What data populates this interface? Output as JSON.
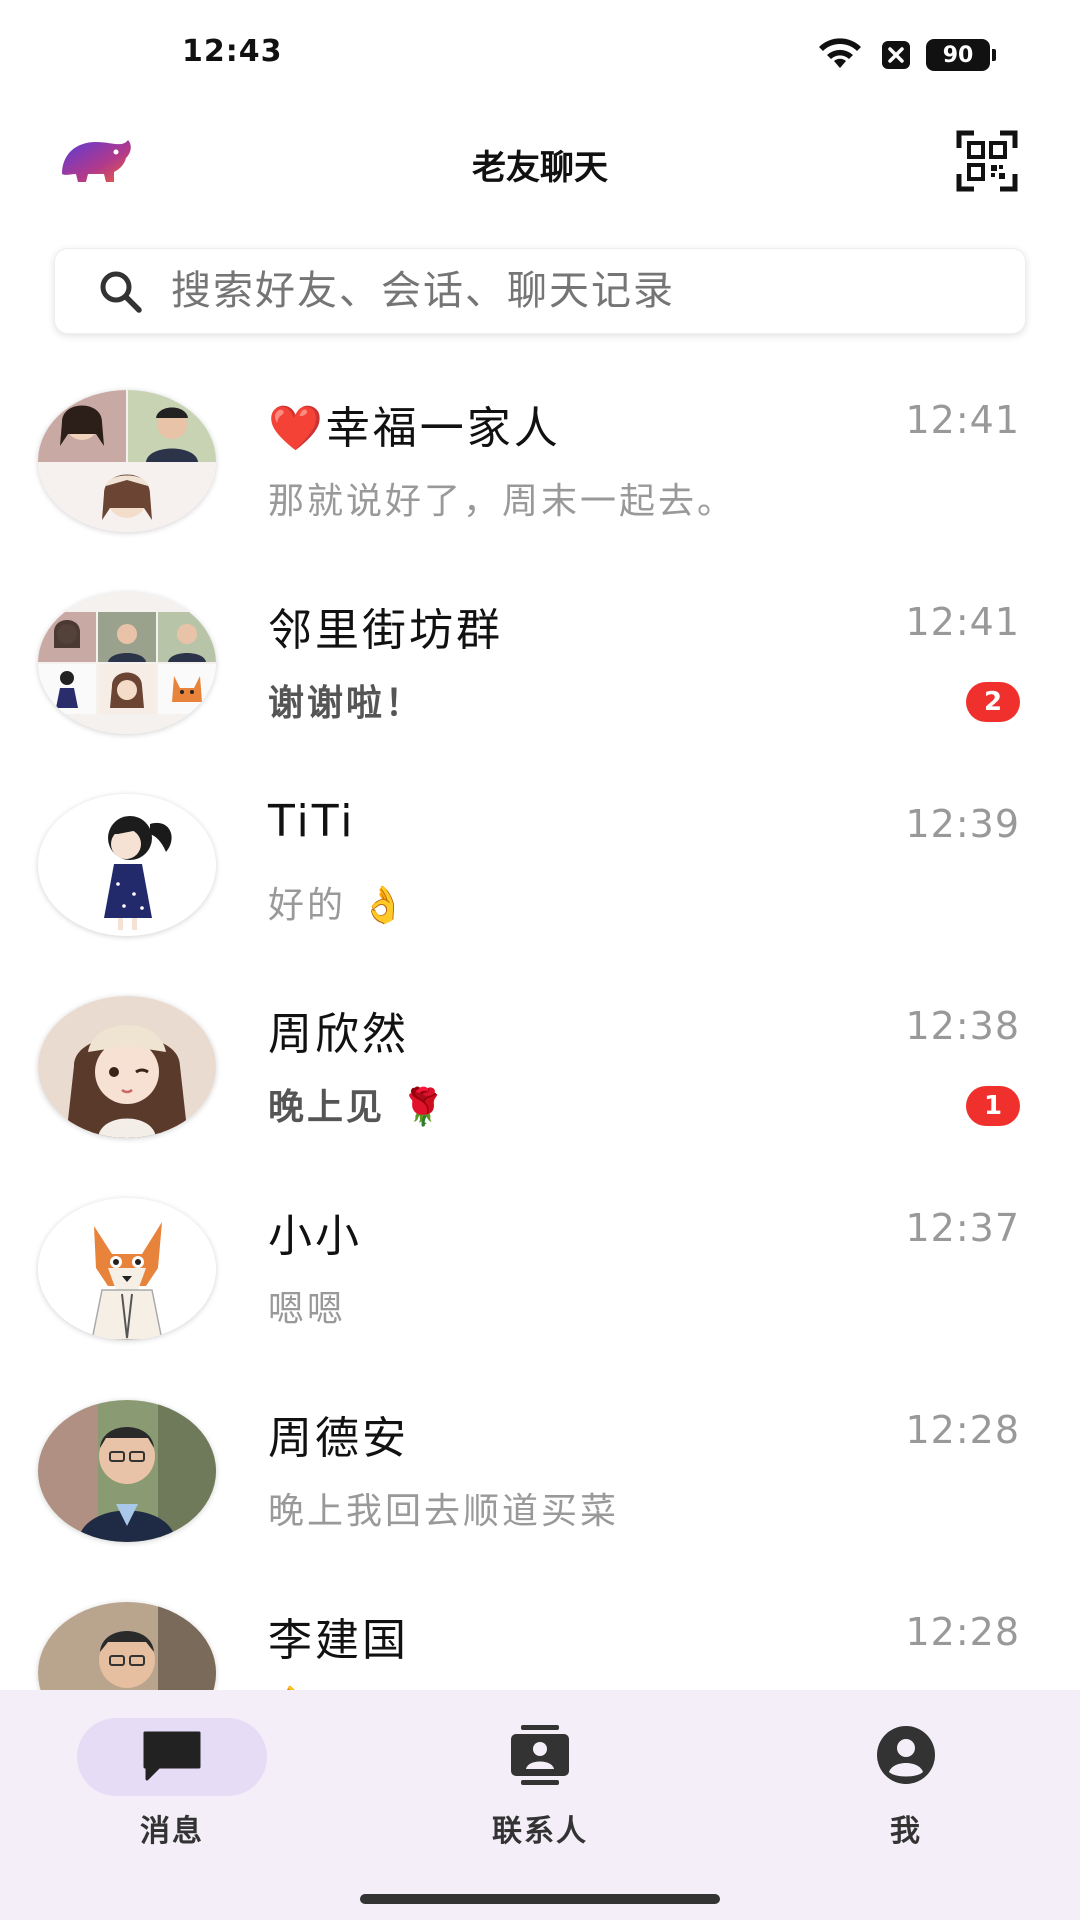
{
  "status_bar": {
    "time": "12:43",
    "battery": "90",
    "icons": [
      "wifi-icon",
      "sim-off-icon",
      "battery-icon"
    ]
  },
  "header": {
    "title": "老友聊天",
    "logo_icon": "elephant-logo-icon",
    "right_icon": "qr-code-icon"
  },
  "search": {
    "placeholder": "搜索好友、会话、聊天记录",
    "icon": "search-icon"
  },
  "chats": [
    {
      "name": "❤️幸福一家人",
      "time": "12:41",
      "preview": "那就说好了，周末一起去。",
      "unread": null,
      "avatar": "group-avatar"
    },
    {
      "name": "邻里街坊群",
      "time": "12:41",
      "preview": "谢谢啦！",
      "unread": "2",
      "avatar": "group-avatar"
    },
    {
      "name": "TiTi",
      "time": "12:39",
      "preview": "好的 👌",
      "unread": null,
      "avatar": "girl-avatar"
    },
    {
      "name": "周欣然",
      "time": "12:38",
      "preview": "晚上见 🌹",
      "unread": "1",
      "avatar": "girl-cap-avatar"
    },
    {
      "name": "小小",
      "time": "12:37",
      "preview": "嗯嗯",
      "unread": null,
      "avatar": "fox-avatar"
    },
    {
      "name": "周德安",
      "time": "12:28",
      "preview": "晚上我回去顺道买菜",
      "unread": null,
      "avatar": "man-avatar"
    },
    {
      "name": "李建国",
      "time": "12:28",
      "preview": "👌",
      "unread": null,
      "avatar": "man-avatar"
    }
  ],
  "bottom_nav": [
    {
      "label": "消息",
      "icon": "chat-bubble-icon",
      "active": true
    },
    {
      "label": "联系人",
      "icon": "contacts-icon",
      "active": false
    },
    {
      "label": "我",
      "icon": "account-circle-icon",
      "active": false
    }
  ],
  "colors": {
    "badge": "#f0302c",
    "nav_bg": "#f3eef8",
    "nav_active_pill": "#e6dcf5",
    "muted_text": "#999999"
  }
}
